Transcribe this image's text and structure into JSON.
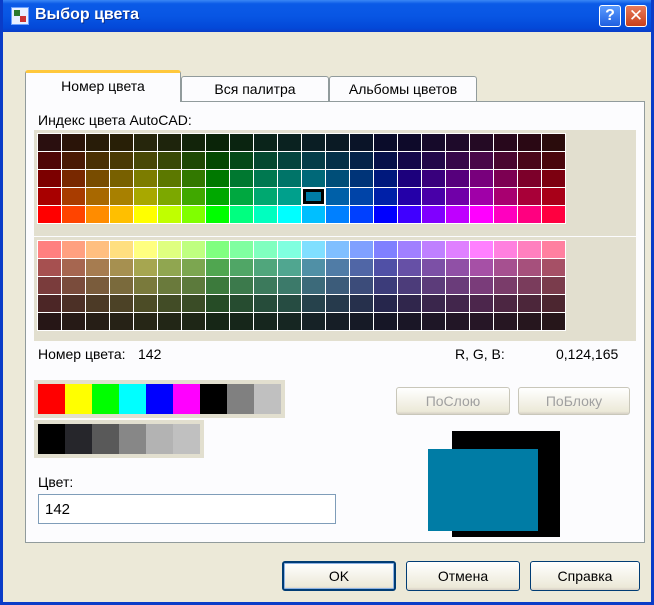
{
  "window": {
    "title": "Выбор цвета",
    "help_label": "?",
    "close_label": "✕"
  },
  "tabs": [
    {
      "label": "Номер цвета",
      "active": true
    },
    {
      "label": "Вся палитра",
      "active": false
    },
    {
      "label": "Альбомы цветов",
      "active": false
    }
  ],
  "index_label": "Индекс цвета AutoCAD:",
  "color_number_label": "Номер цвета:",
  "color_number_value": "142",
  "rgb_label": "R, G, B:",
  "rgb_value": "0,124,165",
  "buttons": {
    "bylayer": "ПоСлою",
    "byblock": "ПоБлоку",
    "ok": "OK",
    "cancel": "Отмена",
    "help": "Справка"
  },
  "color_field_label": "Цвет:",
  "color_field_value": "142",
  "selected_color": "#007ca5",
  "grid_top": [
    [
      "#2a0f0f",
      "#2a1408",
      "#281c08",
      "#281f06",
      "#26260c",
      "#1e240c",
      "#12240a",
      "#0a2408",
      "#0a2410",
      "#0a241a",
      "#0a2220",
      "#0a1e24",
      "#0a1a24",
      "#0a1428",
      "#0a0c2a",
      "#0e0a2a",
      "#160a2a",
      "#1e0a2a",
      "#240a24",
      "#28081c",
      "#2a0814",
      "#2a0c0c"
    ],
    [
      "#4e0606",
      "#4a1a04",
      "#4a3004",
      "#4a3a04",
      "#484806",
      "#384806",
      "#1e4804",
      "#044802",
      "#044818",
      "#044830",
      "#04443e",
      "#043c48",
      "#043048",
      "#042248",
      "#06104a",
      "#14084a",
      "#22084a",
      "#36084a",
      "#480848",
      "#4a0630",
      "#4a061a",
      "#4a060c"
    ],
    [
      "#7c0000",
      "#782800",
      "#784c00",
      "#786000",
      "#7c7c00",
      "#5c7800",
      "#327800",
      "#007800",
      "#007830",
      "#007850",
      "#007468",
      "#006878",
      "#004e78",
      "#003478",
      "#00187c",
      "#1c007c",
      "#38007c",
      "#56007c",
      "#78007c",
      "#7c0052",
      "#7c002a",
      "#7c0010"
    ],
    [
      "#a80000",
      "#a83c00",
      "#a86800",
      "#a88000",
      "#a8a800",
      "#7ca800",
      "#40a800",
      "#00a800",
      "#00a840",
      "#00a870",
      "#00a08c",
      "#007ca5",
      "#0060a8",
      "#0044a8",
      "#0020a8",
      "#2400a8",
      "#4800a8",
      "#7000a8",
      "#a000a8",
      "#a80070",
      "#a80038",
      "#a80018"
    ],
    [
      "#ff0000",
      "#ff4400",
      "#ff8c00",
      "#ffbf00",
      "#ffff00",
      "#c0ff00",
      "#80ff00",
      "#00ff00",
      "#00ff80",
      "#00ffbf",
      "#00ffff",
      "#00bfff",
      "#0080ff",
      "#0040ff",
      "#0000ff",
      "#4000ff",
      "#8000ff",
      "#bf00ff",
      "#ff00ff",
      "#ff00bf",
      "#ff0080",
      "#ff0040"
    ]
  ],
  "grid_bottom": [
    [
      "#ff8080",
      "#ffa080",
      "#ffbf80",
      "#ffdf80",
      "#ffff80",
      "#dfff80",
      "#bfff80",
      "#80ff80",
      "#80ffa0",
      "#80ffbf",
      "#80ffdf",
      "#80dfff",
      "#80bfff",
      "#80a0ff",
      "#8080ff",
      "#a080ff",
      "#bf80ff",
      "#df80ff",
      "#ff80ff",
      "#ff80df",
      "#ff80bf",
      "#ff80a0"
    ],
    [
      "#a65050",
      "#a66650",
      "#a67c50",
      "#a69050",
      "#a6a650",
      "#90a650",
      "#7ca650",
      "#50a650",
      "#50a666",
      "#50a67c",
      "#50a690",
      "#5090a6",
      "#507ca6",
      "#5066a6",
      "#5050a6",
      "#6650a6",
      "#7c50a6",
      "#9050a6",
      "#a650a6",
      "#a65090",
      "#a6507c",
      "#a65066"
    ],
    [
      "#7a3c3c",
      "#7a4c3c",
      "#7a5c3c",
      "#7a6a3c",
      "#7a7a3c",
      "#6a7a3c",
      "#5c7a3c",
      "#3c7a3c",
      "#3c7a4c",
      "#3c7a5c",
      "#3c7a6a",
      "#3c6a7a",
      "#3c5c7a",
      "#3c4c7a",
      "#3c3c7a",
      "#4c3c7a",
      "#5c3c7a",
      "#6a3c7a",
      "#7a3c7a",
      "#7a3c6a",
      "#7a3c5c",
      "#7a3c4c"
    ],
    [
      "#4c2626",
      "#4c3026",
      "#4c3a26",
      "#4c4226",
      "#4c4c26",
      "#424c26",
      "#3a4c26",
      "#264c26",
      "#264c30",
      "#264c3a",
      "#264c42",
      "#26424c",
      "#263a4c",
      "#26304c",
      "#26264c",
      "#30264c",
      "#3a264c",
      "#42264c",
      "#4c264c",
      "#4c2642",
      "#4c263a",
      "#4c2630"
    ],
    [
      "#261616",
      "#261a16",
      "#261e16",
      "#262216",
      "#262616",
      "#222616",
      "#1e2616",
      "#162616",
      "#16261a",
      "#16261e",
      "#162622",
      "#162226",
      "#161e26",
      "#161a26",
      "#161626",
      "#1a1626",
      "#1e1626",
      "#221626",
      "#261626",
      "#261622",
      "#26161e",
      "#26161a"
    ]
  ],
  "standard_colors": [
    "#ff0000",
    "#ffff00",
    "#00ff00",
    "#00ffff",
    "#0000ff",
    "#ff00ff",
    "#000000",
    "#808080",
    "#c0c0c0"
  ],
  "gray_colors": [
    "#000000",
    "#26262b",
    "#595959",
    "#878787",
    "#b3b3b3",
    "#c0c0c0"
  ],
  "preview_back_color": "#000000"
}
